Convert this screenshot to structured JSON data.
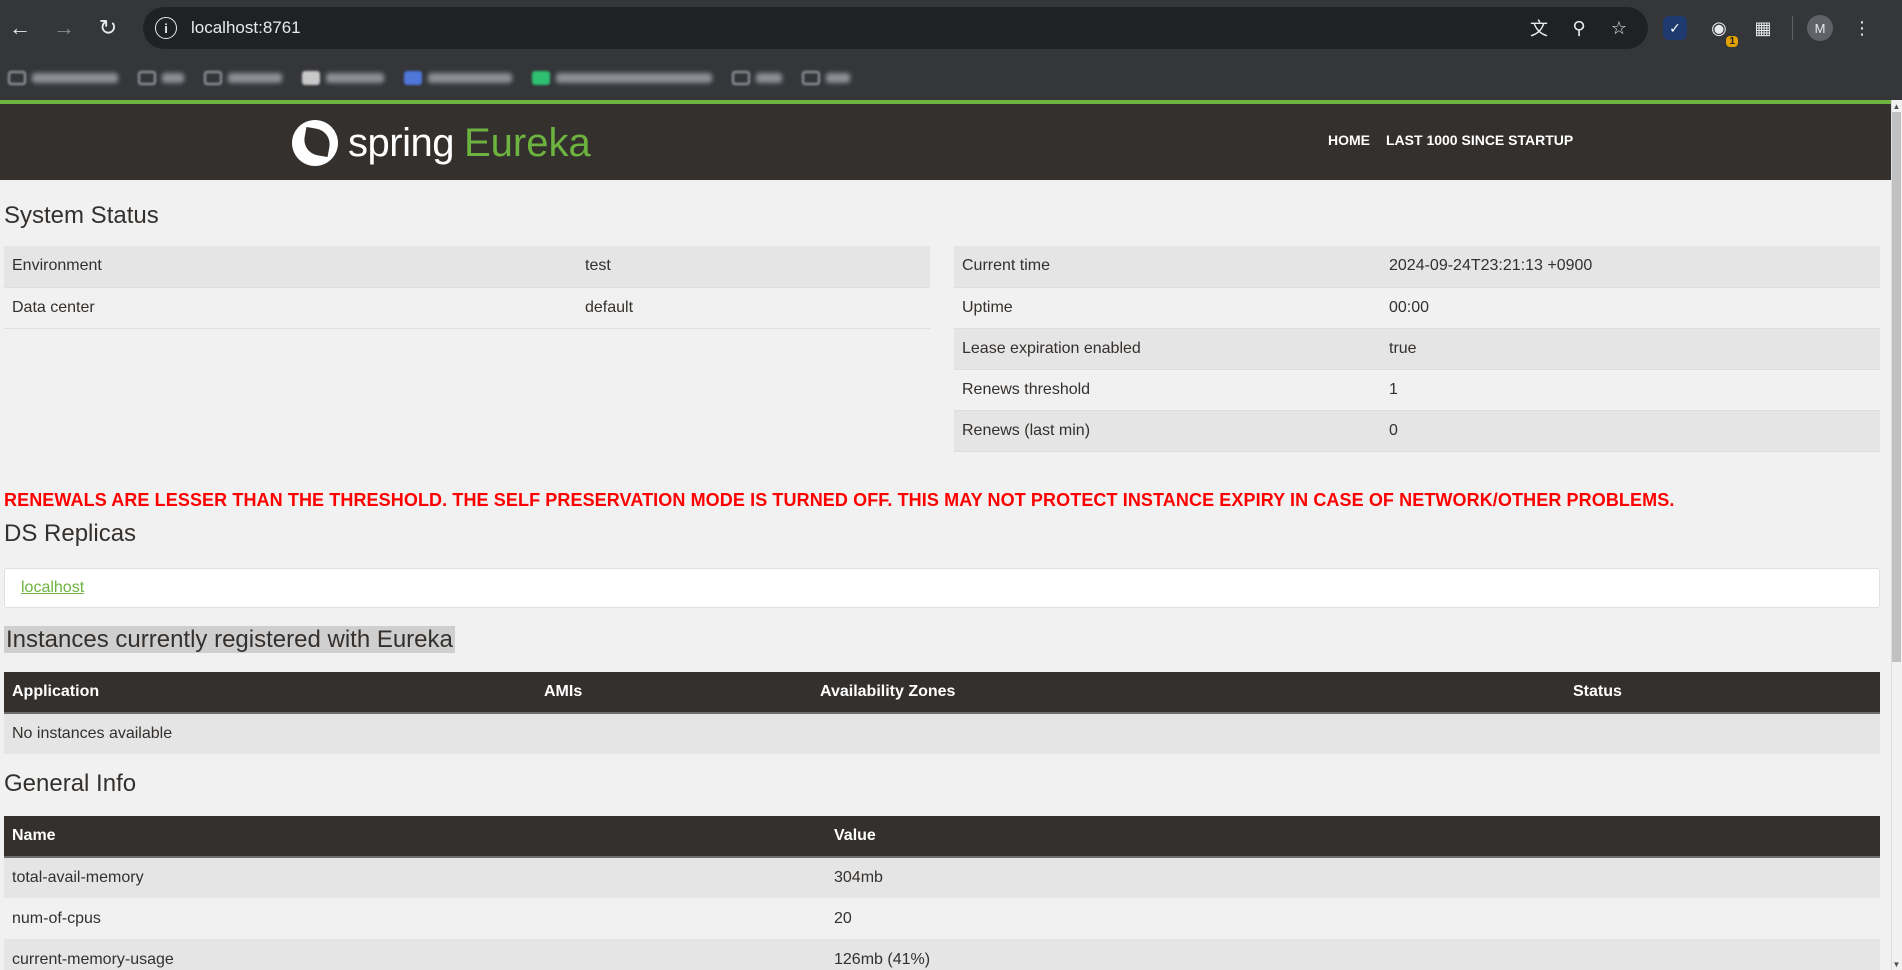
{
  "browser": {
    "url": "localhost:8761",
    "avatar_initial": "M",
    "extension_badge": "1"
  },
  "navbar": {
    "logo_word1": "spring",
    "logo_word2": "Eureka",
    "links": [
      "HOME",
      "LAST 1000 SINCE STARTUP"
    ]
  },
  "system_status": {
    "title": "System Status",
    "left": [
      {
        "label": "Environment",
        "value": "test"
      },
      {
        "label": "Data center",
        "value": "default"
      }
    ],
    "right": [
      {
        "label": "Current time",
        "value": "2024-09-24T23:21:13 +0900"
      },
      {
        "label": "Uptime",
        "value": "00:00"
      },
      {
        "label": "Lease expiration enabled",
        "value": "true"
      },
      {
        "label": "Renews threshold",
        "value": "1"
      },
      {
        "label": "Renews (last min)",
        "value": "0"
      }
    ]
  },
  "warning": "RENEWALS ARE LESSER THAN THE THRESHOLD. THE SELF PRESERVATION MODE IS TURNED OFF. THIS MAY NOT PROTECT INSTANCE EXPIRY IN CASE OF NETWORK/OTHER PROBLEMS.",
  "ds_replicas": {
    "title": "DS Replicas",
    "link": "localhost"
  },
  "instances": {
    "title": "Instances currently registered with Eureka",
    "columns": [
      "Application",
      "AMIs",
      "Availability Zones",
      "Status"
    ],
    "empty_text": "No instances available"
  },
  "general_info": {
    "title": "General Info",
    "columns": [
      "Name",
      "Value"
    ],
    "rows": [
      {
        "name": "total-avail-memory",
        "value": "304mb"
      },
      {
        "name": "num-of-cpus",
        "value": "20"
      },
      {
        "name": "current-memory-usage",
        "value": "126mb (41%)"
      }
    ]
  },
  "colors": {
    "brand_green": "#6db33f",
    "navbar_bg": "#34302d",
    "warning_red": "#ff0000"
  }
}
